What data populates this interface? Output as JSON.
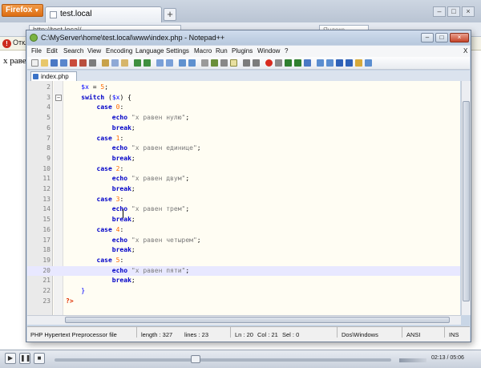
{
  "browser": {
    "menu_label": "Firefox",
    "tab_title": "test.local",
    "url": "http://test.local/",
    "search_placeholder": "Яндекс",
    "notice_text": "Откл",
    "page_text": "x равен"
  },
  "editor_window": {
    "title": "C:\\MyServer\\home\\test.local\\www\\index.php - Notepad++",
    "menu": [
      "File",
      "Edit",
      "Search",
      "View",
      "Encoding",
      "Language",
      "Settings",
      "Macro",
      "Run",
      "Plugins",
      "Window",
      "?"
    ],
    "menu_close": "X",
    "tab_label": "index.php",
    "lines": [
      {
        "num": "2",
        "fold": "",
        "code": [
          {
            "t": "var",
            "v": "    $x"
          },
          {
            "t": "op",
            "v": " = "
          },
          {
            "t": "num",
            "v": "5"
          },
          {
            "t": "op",
            "v": ";"
          }
        ]
      },
      {
        "num": "3",
        "fold": "−",
        "code": [
          {
            "t": "kw",
            "v": "    switch"
          },
          {
            "t": "op",
            "v": " ("
          },
          {
            "t": "var",
            "v": "$x"
          },
          {
            "t": "op",
            "v": ") {"
          }
        ]
      },
      {
        "num": "4",
        "fold": "",
        "code": [
          {
            "t": "kw",
            "v": "        case"
          },
          {
            "t": "op",
            "v": " "
          },
          {
            "t": "num",
            "v": "0"
          },
          {
            "t": "op",
            "v": ":"
          }
        ]
      },
      {
        "num": "5",
        "fold": "",
        "code": [
          {
            "t": "kw",
            "v": "            echo"
          },
          {
            "t": "op",
            "v": " "
          },
          {
            "t": "str",
            "v": "\"x равен нулю\""
          },
          {
            "t": "op",
            "v": ";"
          }
        ]
      },
      {
        "num": "6",
        "fold": "",
        "code": [
          {
            "t": "kw",
            "v": "            break"
          },
          {
            "t": "op",
            "v": ";"
          }
        ]
      },
      {
        "num": "7",
        "fold": "",
        "code": [
          {
            "t": "kw",
            "v": "        case"
          },
          {
            "t": "op",
            "v": " "
          },
          {
            "t": "num",
            "v": "1"
          },
          {
            "t": "op",
            "v": ":"
          }
        ]
      },
      {
        "num": "8",
        "fold": "",
        "code": [
          {
            "t": "kw",
            "v": "            echo"
          },
          {
            "t": "op",
            "v": " "
          },
          {
            "t": "str",
            "v": "\"x равен единице\""
          },
          {
            "t": "op",
            "v": ";"
          }
        ]
      },
      {
        "num": "9",
        "fold": "",
        "code": [
          {
            "t": "kw",
            "v": "            break"
          },
          {
            "t": "op",
            "v": ";"
          }
        ]
      },
      {
        "num": "10",
        "fold": "",
        "code": [
          {
            "t": "kw",
            "v": "        case"
          },
          {
            "t": "op",
            "v": " "
          },
          {
            "t": "num",
            "v": "2"
          },
          {
            "t": "op",
            "v": ":"
          }
        ]
      },
      {
        "num": "11",
        "fold": "",
        "code": [
          {
            "t": "kw",
            "v": "            echo"
          },
          {
            "t": "op",
            "v": " "
          },
          {
            "t": "str",
            "v": "\"x равен двум\""
          },
          {
            "t": "op",
            "v": ";"
          }
        ]
      },
      {
        "num": "12",
        "fold": "",
        "code": [
          {
            "t": "kw",
            "v": "            break"
          },
          {
            "t": "op",
            "v": ";"
          }
        ]
      },
      {
        "num": "13",
        "fold": "",
        "code": [
          {
            "t": "kw",
            "v": "        case"
          },
          {
            "t": "op",
            "v": " "
          },
          {
            "t": "num",
            "v": "3"
          },
          {
            "t": "op",
            "v": ":"
          }
        ]
      },
      {
        "num": "14",
        "fold": "",
        "code": [
          {
            "t": "kw",
            "v": "            echo"
          },
          {
            "t": "op",
            "v": " "
          },
          {
            "t": "str",
            "v": "\"x равен трем\""
          },
          {
            "t": "op",
            "v": ";"
          }
        ]
      },
      {
        "num": "15",
        "fold": "",
        "code": [
          {
            "t": "kw",
            "v": "            break"
          },
          {
            "t": "op",
            "v": ";"
          }
        ]
      },
      {
        "num": "16",
        "fold": "",
        "code": [
          {
            "t": "kw",
            "v": "        case"
          },
          {
            "t": "op",
            "v": " "
          },
          {
            "t": "num",
            "v": "4"
          },
          {
            "t": "op",
            "v": ":"
          }
        ]
      },
      {
        "num": "17",
        "fold": "",
        "code": [
          {
            "t": "kw",
            "v": "            echo"
          },
          {
            "t": "op",
            "v": " "
          },
          {
            "t": "str",
            "v": "\"x равен четырем\""
          },
          {
            "t": "op",
            "v": ";"
          }
        ]
      },
      {
        "num": "18",
        "fold": "",
        "code": [
          {
            "t": "kw",
            "v": "            break"
          },
          {
            "t": "op",
            "v": ";"
          }
        ]
      },
      {
        "num": "19",
        "fold": "",
        "code": [
          {
            "t": "kw",
            "v": "        case"
          },
          {
            "t": "op",
            "v": " "
          },
          {
            "t": "num",
            "v": "5"
          },
          {
            "t": "op",
            "v": ":"
          }
        ]
      },
      {
        "num": "20",
        "fold": "",
        "highlight": true,
        "code": [
          {
            "t": "kw",
            "v": "            echo"
          },
          {
            "t": "op",
            "v": " "
          },
          {
            "t": "str",
            "v": "\"x равен пяти\""
          },
          {
            "t": "op",
            "v": ";"
          }
        ]
      },
      {
        "num": "21",
        "fold": "",
        "code": [
          {
            "t": "kw",
            "v": "            break"
          },
          {
            "t": "op",
            "v": ";"
          }
        ]
      },
      {
        "num": "22",
        "fold": "",
        "code": [
          {
            "t": "kw",
            "v": "    "
          },
          {
            "t": "var",
            "v": "}"
          }
        ]
      },
      {
        "num": "23",
        "fold": "",
        "code": [
          {
            "t": "php",
            "v": "?>"
          }
        ]
      }
    ],
    "status": {
      "file_type": "PHP Hypertext Preprocessor file",
      "length": "length : 327",
      "lines": "lines : 23",
      "ln": "Ln : 20",
      "col": "Col : 21",
      "sel": "Sel : 0",
      "eol": "Dos\\Windows",
      "encoding": "ANSI",
      "mode": "INS"
    }
  },
  "player": {
    "time": "02:13 / 05:06"
  },
  "colors": {
    "keyword": "#0000c8",
    "variable": "#0000ff",
    "number": "#ff6a00",
    "string": "#7a7a7a",
    "php_tag": "#e03000",
    "current_line": "#e8e8ff"
  }
}
